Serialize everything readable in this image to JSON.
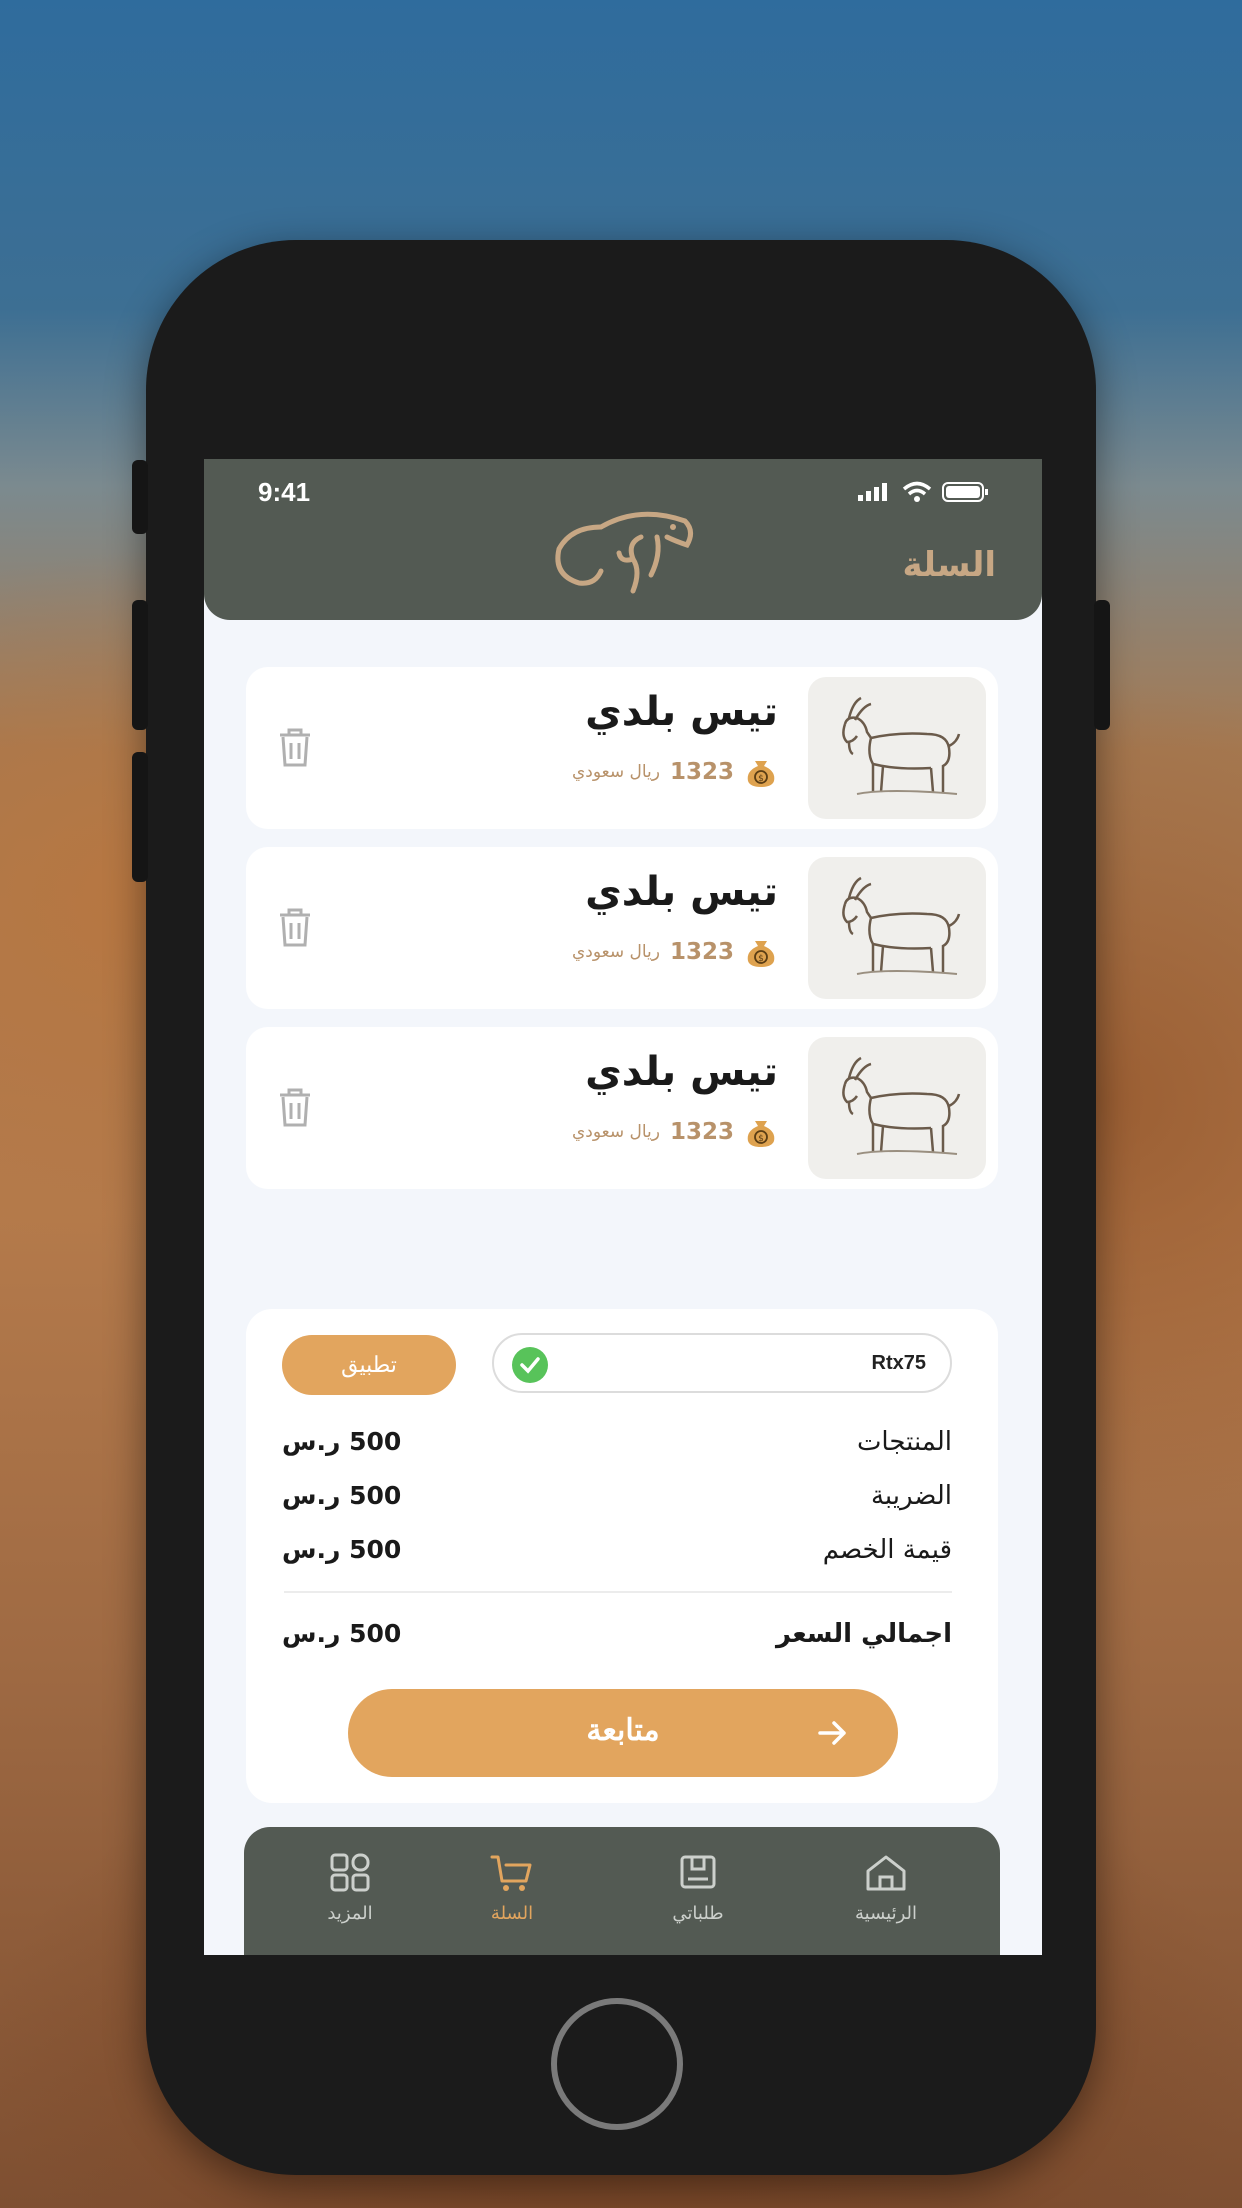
{
  "status": {
    "time": "9:41"
  },
  "header": {
    "title": "السلة"
  },
  "cart": {
    "items": [
      {
        "name": "تيس بلدي",
        "price": "1323",
        "currency": "ريال سعودي"
      },
      {
        "name": "تيس بلدي",
        "price": "1323",
        "currency": "ريال سعودي"
      },
      {
        "name": "تيس بلدي",
        "price": "1323",
        "currency": "ريال سعودي"
      }
    ]
  },
  "coupon": {
    "code": "Rtx75",
    "apply_label": "تطبيق"
  },
  "summary": {
    "products_label": "المنتجات",
    "products_value": "500 ر.س",
    "tax_label": "الضريبة",
    "tax_value": "500 ر.س",
    "discount_label": "قيمة الخصم",
    "discount_value": "500 ر.س",
    "total_label": "اجمالي السعر",
    "total_value": "500 ر.س"
  },
  "continue_label": "متابعة",
  "tabs": [
    {
      "label": "الرئيسية",
      "icon": "home-icon"
    },
    {
      "label": "طلباتي",
      "icon": "orders-icon"
    },
    {
      "label": "السلة",
      "icon": "cart-icon",
      "active": true
    },
    {
      "label": "المزيد",
      "icon": "grid-icon"
    }
  ],
  "colors": {
    "header": "#535a53",
    "accent": "#e2a55e",
    "price": "#b8926a",
    "check": "#58c35a"
  }
}
